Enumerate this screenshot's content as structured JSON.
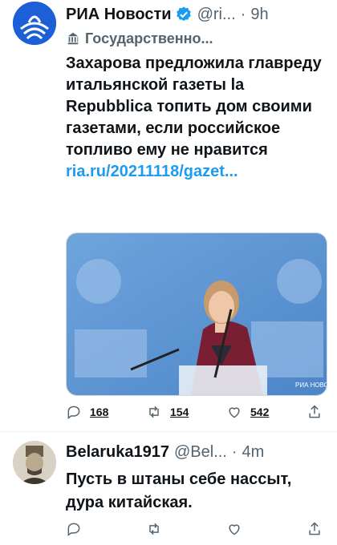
{
  "tweet1": {
    "author_name": "РИА Новости",
    "handle": "@ri...",
    "time": "9h",
    "label": "Государственно...",
    "text": "Захарова предложила главреду итальянской газеты la Repubblica топить дом своими газетами, если российское топливо ему не нравится",
    "link": "ria.ru/20211118/gazet...",
    "media_watermark": "РИА НОВОСТИ",
    "replies": "168",
    "retweets": "154",
    "likes": "542"
  },
  "tweet2": {
    "author_name": "Belaruka1917",
    "handle": "@Bel...",
    "time": "4m",
    "text": "Пусть в штаны себе нассыт, дура китайская."
  },
  "colors": {
    "accent": "#1d9bf0",
    "muted": "#536471",
    "text": "#0f1419"
  }
}
